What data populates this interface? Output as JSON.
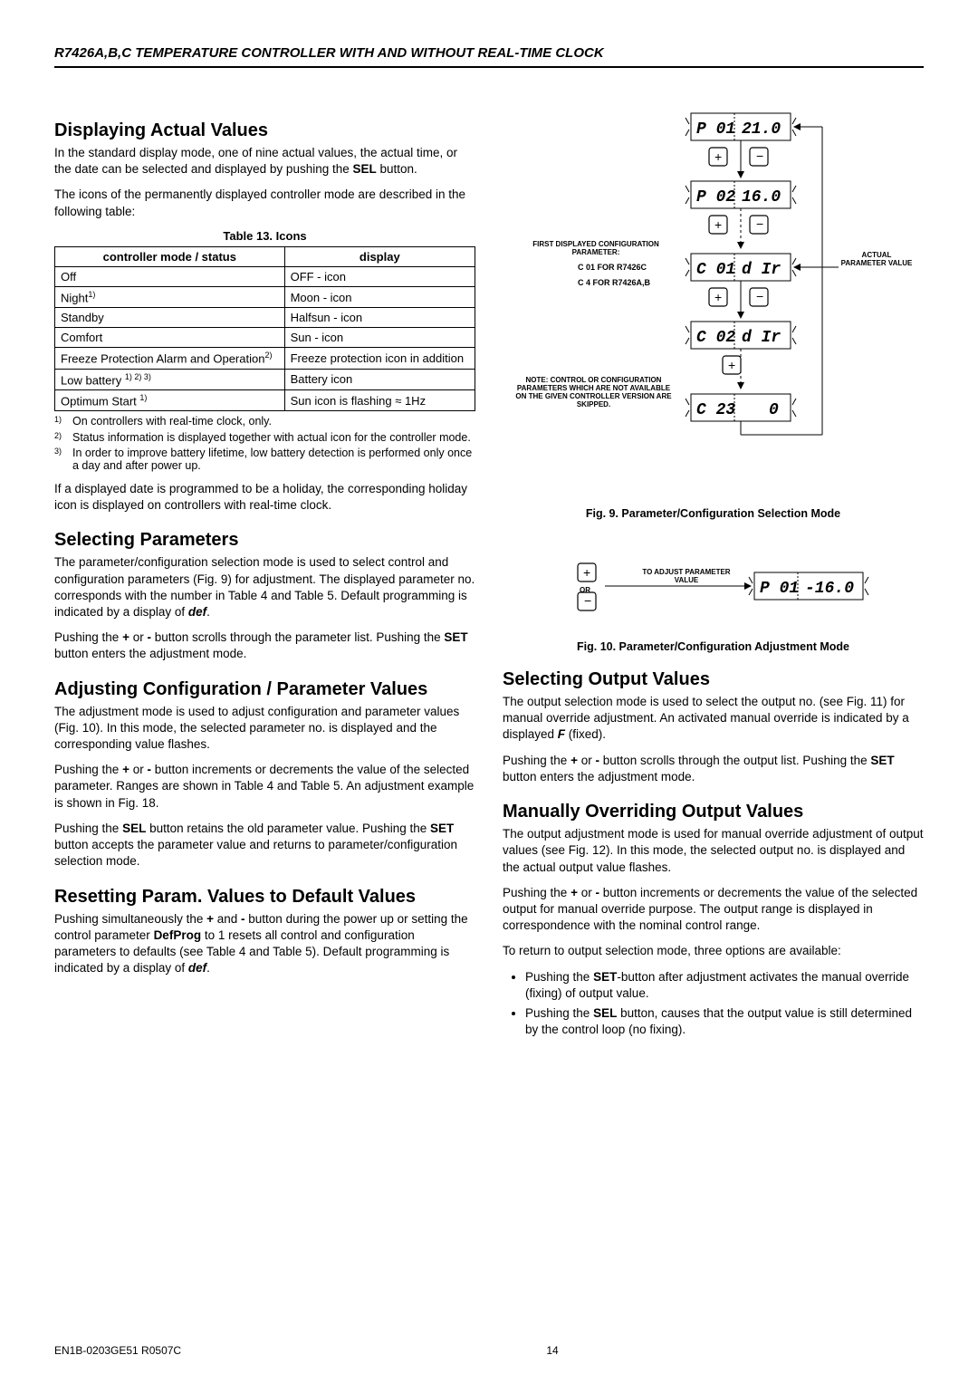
{
  "header": "R7426A,B,C TEMPERATURE CONTROLLER WITH AND WITHOUT REAL-TIME CLOCK",
  "left": {
    "h1": "Displaying Actual Values",
    "p1a": "In the standard display mode, one of nine actual values, the actual time, or the date can be selected and displayed by pushing the ",
    "p1b": " button.",
    "p2": "The icons of the permanently displayed controller mode are described in the following table:",
    "tableTitle": "Table 13. Icons",
    "th1": "controller mode / status",
    "th2": "display",
    "rows": [
      {
        "a": "Off",
        "b": "OFF - icon"
      },
      {
        "a": "Night",
        "asup": "1)",
        "b": "Moon - icon"
      },
      {
        "a": "Standby",
        "b": "Halfsun - icon"
      },
      {
        "a": "Comfort",
        "b": "Sun - icon"
      },
      {
        "a": "Freeze Protection Alarm and Operation",
        "asup": "2)",
        "b": "Freeze protection icon in addition"
      },
      {
        "a": "Low battery ",
        "asup": "1) 2) 3)",
        "b": "Battery icon"
      },
      {
        "a": "Optimum Start ",
        "asup": "1)",
        "b": "Sun icon is flashing ≈ 1Hz"
      }
    ],
    "fn1": "On controllers with real-time clock, only.",
    "fn2": "Status information is displayed together with actual icon for the controller mode.",
    "fn3": "In order to improve battery lifetime, low battery detection is performed only once a day and after power up.",
    "p3": "If a displayed date is programmed to be a holiday, the corresponding holiday icon is displayed on controllers with real-time clock.",
    "h2": "Selecting Parameters",
    "p4": "The parameter/configuration selection mode is used to select control and configuration parameters (Fig. 9) for adjustment. The displayed parameter no. corresponds with the number in Table 4 and Table 5. Default programming is indicated by a display of ",
    "p4b": ".",
    "p5a": "Pushing the ",
    "p5b": " or ",
    "p5c": " button scrolls through the parameter list. Pushing the ",
    "p5d": " button enters the adjustment mode.",
    "h3": "Adjusting Configuration / Parameter Values",
    "p6": "The adjustment mode is used to adjust configuration and parameter values (Fig. 10). In this mode, the selected parameter no. is displayed and the corresponding value flashes.",
    "p7a": "Pushing the ",
    "p7b": " or ",
    "p7c": " button increments or decrements the value of the selected parameter. Ranges are shown in Table 4 and Table 5. An adjustment example is shown in Fig. 18.",
    "p8a": "Pushing the ",
    "p8b": " button retains the old parameter value. Pushing the ",
    "p8c": " button accepts the parameter value and returns to parameter/configuration selection mode.",
    "h4": "Resetting Param. Values to Default Values",
    "p9a": "Pushing simultaneously the ",
    "p9b": " and ",
    "p9c": " button during the power up or setting the control parameter ",
    "p9d": " to 1 resets all control and configuration parameters to defaults (see Table 4 and Table 5). Default programming is indicated by a display of ",
    "p9e": "."
  },
  "right": {
    "fig9": {
      "d1l": "P 01",
      "d1r": "21.0",
      "d2l": "P 02",
      "d2r": "16.0",
      "d3l": "C 01",
      "d3r": "d Ir",
      "d4l": "C 02",
      "d4r": "d Ir",
      "d5l": "C 23",
      "d5r": "0",
      "lblFirst": "FIRST DISPLAYED CONFIGURATION PARAMETER:",
      "lblC01": "C 01  FOR R7426C",
      "lblC4": "C 4  FOR R7426A,B",
      "lblActual": "ACTUAL PARAMETER VALUE",
      "lblNote": "NOTE: CONTROL OR CONFIGURATION PARAMETERS WHICH ARE NOT AVAILABLE ON THE GIVEN CONTROLLER VERSION ARE SKIPPED.",
      "caption": "Fig. 9. Parameter/Configuration Selection Mode"
    },
    "fig10": {
      "lblAdj": "TO ADJUST PARAMETER VALUE",
      "dl": "P 01",
      "dr": "-16.0",
      "caption": "Fig. 10. Parameter/Configuration Adjustment Mode"
    },
    "h5": "Selecting Output Values",
    "p10a": "The output selection mode is used to select the output no. (see Fig. 11) for manual override adjustment. An activated manual override is indicated by a displayed ",
    "p10b": " (fixed).",
    "p11a": "Pushing the ",
    "p11b": " or ",
    "p11c": " button scrolls through the output list. Pushing the ",
    "p11d": " button enters the adjustment mode.",
    "h6": "Manually Overriding Output Values",
    "p12": "The output adjustment mode is used for manual override adjustment of output values (see Fig. 12). In this mode, the selected output no. is displayed and the actual output value flashes.",
    "p13a": "Pushing the ",
    "p13b": " or ",
    "p13c": " button increments or decrements the value of the selected output for manual override purpose. The output range is displayed in correspondence with the nominal control range.",
    "p14": "To return to output selection mode, three options are available:",
    "li1a": "Pushing the ",
    "li1b": "-button after adjustment activates the manual override (fixing) of output value.",
    "li2a": "Pushing the ",
    "li2b": " button, causes that the output value is still determined by the control loop (no fixing)."
  },
  "footer": {
    "left": "EN1B-0203GE51 R0507C",
    "page": "14"
  },
  "bold": {
    "SEL": "SEL",
    "SET": "SET",
    "def": "def",
    "DefProg": "DefProg",
    "plus": "+",
    "minus": "-",
    "F": "F"
  }
}
